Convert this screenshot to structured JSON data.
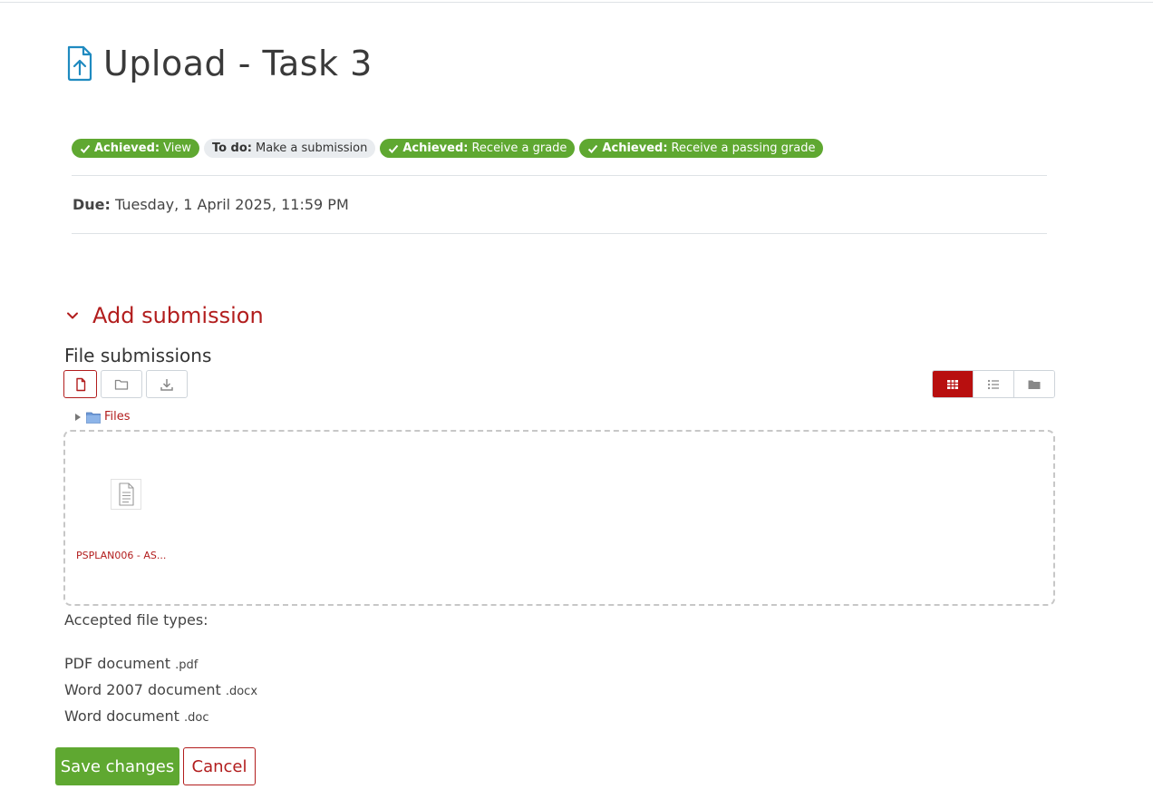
{
  "page": {
    "title": "Upload - Task 3",
    "icon": "file-upload-icon",
    "accent_color": "#b21d1d",
    "success_color": "#5fa831"
  },
  "completion": [
    {
      "status": "Achieved:",
      "label": "View",
      "state": "achieved"
    },
    {
      "status": "To do:",
      "label": "Make a submission",
      "state": "todo"
    },
    {
      "status": "Achieved:",
      "label": "Receive a grade",
      "state": "achieved"
    },
    {
      "status": "Achieved:",
      "label": "Receive a passing grade",
      "state": "achieved"
    }
  ],
  "due": {
    "label": "Due:",
    "value": "Tuesday, 1 April 2025, 11:59 PM"
  },
  "section": {
    "title": "Add submission",
    "expanded": true
  },
  "file_submissions": {
    "label": "File submissions",
    "toolbar": [
      "add-file-icon",
      "create-folder-icon",
      "download-icon"
    ],
    "views": [
      "grid-view-icon",
      "list-view-icon",
      "tree-view-icon"
    ],
    "active_view": "grid-view-icon",
    "path_label": "Files",
    "files": [
      {
        "name": "PSPLAN006 - AS..."
      }
    ]
  },
  "accepted": {
    "label": "Accepted file types:",
    "types": [
      {
        "name": "PDF document",
        "ext": ".pdf"
      },
      {
        "name": "Word 2007 document",
        "ext": ".docx"
      },
      {
        "name": "Word document",
        "ext": ".doc"
      }
    ]
  },
  "actions": {
    "save": "Save changes",
    "cancel": "Cancel"
  }
}
